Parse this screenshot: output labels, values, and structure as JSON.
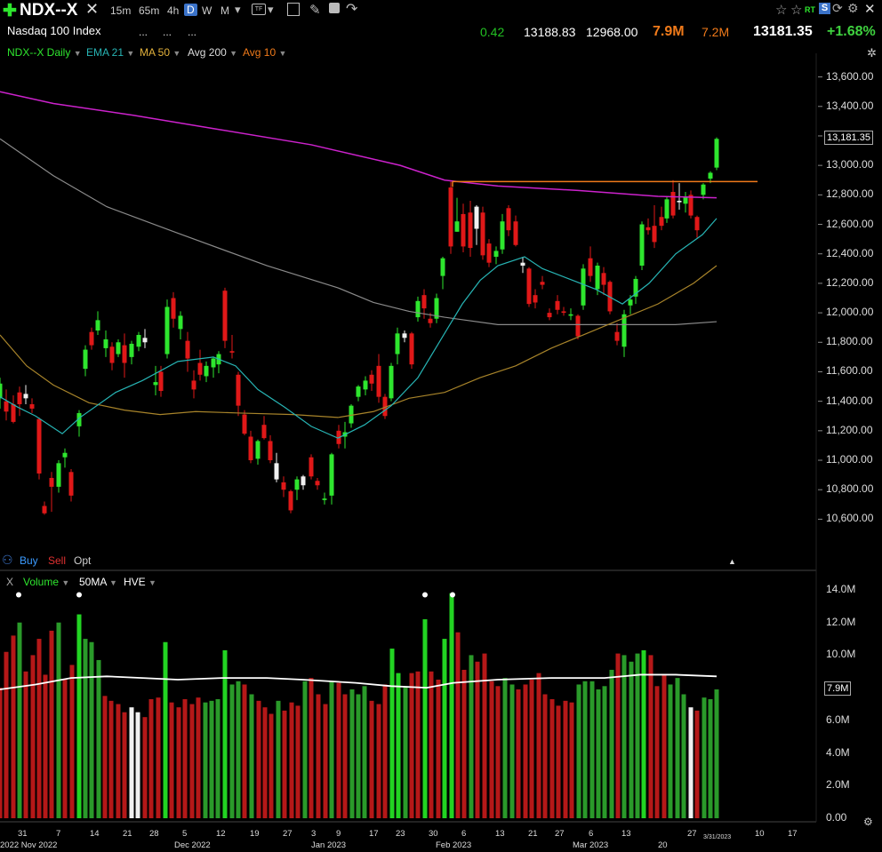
{
  "header": {
    "symbol": "NDX--X",
    "timeframes": [
      "15m",
      "65m",
      "4h",
      "D",
      "W",
      "M"
    ],
    "active_timeframe": "D",
    "description": "Nasdaq 100 Index",
    "dots": [
      "...",
      "...",
      "..."
    ],
    "right_icons": [
      "star-icon",
      "star-outline-icon",
      "RT",
      "S",
      "refresh-icon",
      "settings-icon",
      "close-icon"
    ]
  },
  "quote": {
    "change": "0.42",
    "high": "13188.83",
    "low": "12968.00",
    "volume": "7.9M",
    "avg_volume": "7.2M",
    "last": "13181.35",
    "change_pct": "+1.68%"
  },
  "legend": {
    "series": "NDX--X Daily",
    "ema": "EMA 21",
    "ma": "MA 50",
    "avg200": "Avg 200",
    "avg10": "Avg 10"
  },
  "trade": {
    "buy": "Buy",
    "sell": "Sell",
    "opt": "Opt"
  },
  "volume_legend": {
    "x": "X",
    "volume": "Volume",
    "ma": "50MA",
    "hve": "HVE"
  },
  "colors": {
    "up": "#2ee62e",
    "down": "#e01818",
    "ema21": "#27b4b4",
    "ma50": "#a8842a",
    "avg200": "#cc22cc",
    "avg10": "#f07a1a",
    "ma200gray": "#8a8a8a",
    "volmaline": "#ffffff",
    "vol_up": "#2a9a2a",
    "vol_down": "#b51818"
  },
  "chart_data": [
    {
      "type": "candlestick",
      "title": "NDX--X Daily",
      "ylim": [
        10500,
        13700
      ],
      "y_ticks": [
        "13,600.00",
        "13,400.00",
        "13,200.00",
        "13,000.00",
        "12,800.00",
        "12,600.00",
        "12,400.00",
        "12,200.00",
        "12,000.00",
        "11,800.00",
        "11,600.00",
        "11,400.00",
        "11,200.00",
        "11,000.00",
        "10,800.00",
        "10,600.00"
      ],
      "last_price_label": "13,181.35",
      "x_tick_labels": [
        "31",
        "2022 Nov 2022",
        "7",
        "14",
        "21",
        "28",
        "Dec 2022",
        "5",
        "12",
        "19",
        "27",
        "Jan 2023",
        "3",
        "9",
        "17",
        "23",
        "30",
        "Feb 2023",
        "6",
        "13",
        "21",
        "27",
        "Mar 2023",
        "6",
        "13",
        "20",
        "27",
        "3/31/2023",
        "10",
        "17"
      ],
      "resistance_level": 12890,
      "last_close": 13181.35
    },
    {
      "type": "bar",
      "title": "Volume",
      "ylim": [
        0,
        14.5
      ],
      "unit": "M",
      "y_ticks": [
        "14.0M",
        "12.0M",
        "10.0M",
        "8.0M",
        "6.0M",
        "4.0M",
        "2.0M",
        "0.00"
      ],
      "last_volume_label": "7.9M",
      "ma_value_approx": 8.6
    }
  ]
}
